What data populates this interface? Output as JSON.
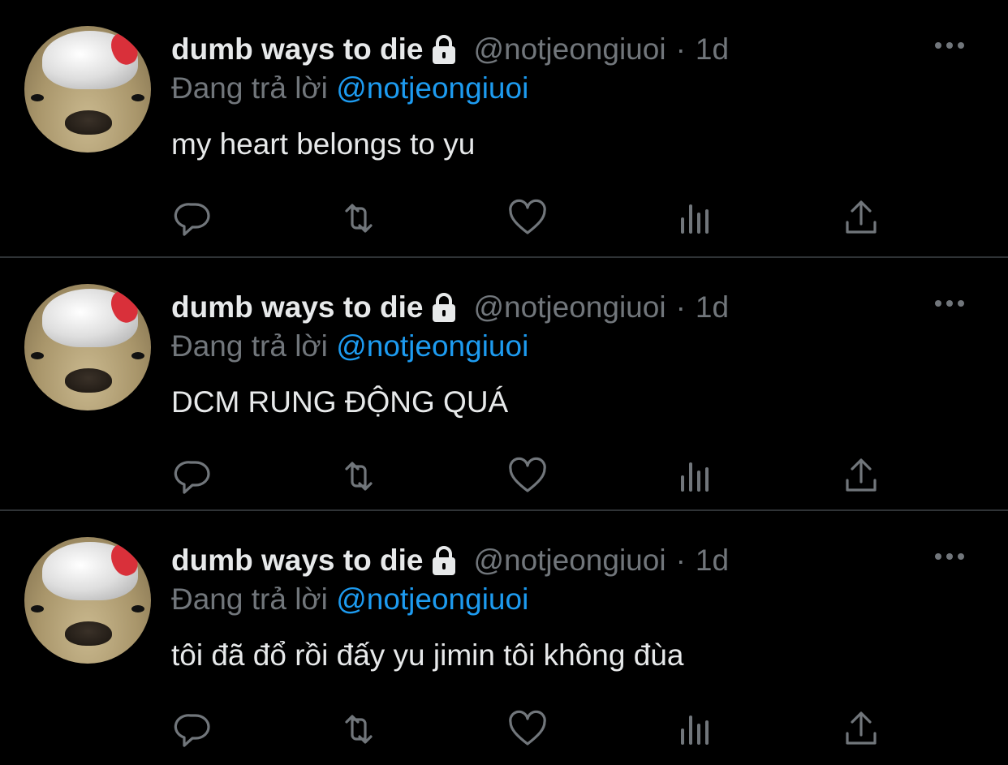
{
  "tweets": [
    {
      "display_name": "dumb ways to die",
      "handle": "@notjeongiuoi",
      "separator": "·",
      "time": "1d",
      "reply_prefix": "Đang trả lời",
      "reply_to": "@notjeongiuoi",
      "text": "my heart belongs to yu"
    },
    {
      "display_name": "dumb ways to die",
      "handle": "@notjeongiuoi",
      "separator": "·",
      "time": "1d",
      "reply_prefix": "Đang trả lời",
      "reply_to": "@notjeongiuoi",
      "text": "DCM RUNG ĐỘNG QUÁ"
    },
    {
      "display_name": "dumb ways to die",
      "handle": "@notjeongiuoi",
      "separator": "·",
      "time": "1d",
      "reply_prefix": "Đang trả lời",
      "reply_to": "@notjeongiuoi",
      "text": "tôi đã đổ rồi đấy yu jimin tôi không đùa"
    }
  ],
  "icons": {
    "lock": "lock-icon",
    "more": "more-horizontal-icon",
    "reply": "reply-icon",
    "retweet": "retweet-icon",
    "like": "like-heart-icon",
    "views": "views-chart-icon",
    "share": "share-icon"
  },
  "colors": {
    "background": "#000000",
    "text_primary": "#e7e9ea",
    "text_secondary": "#71767b",
    "link": "#1d9bf0",
    "divider": "#2f3336"
  }
}
